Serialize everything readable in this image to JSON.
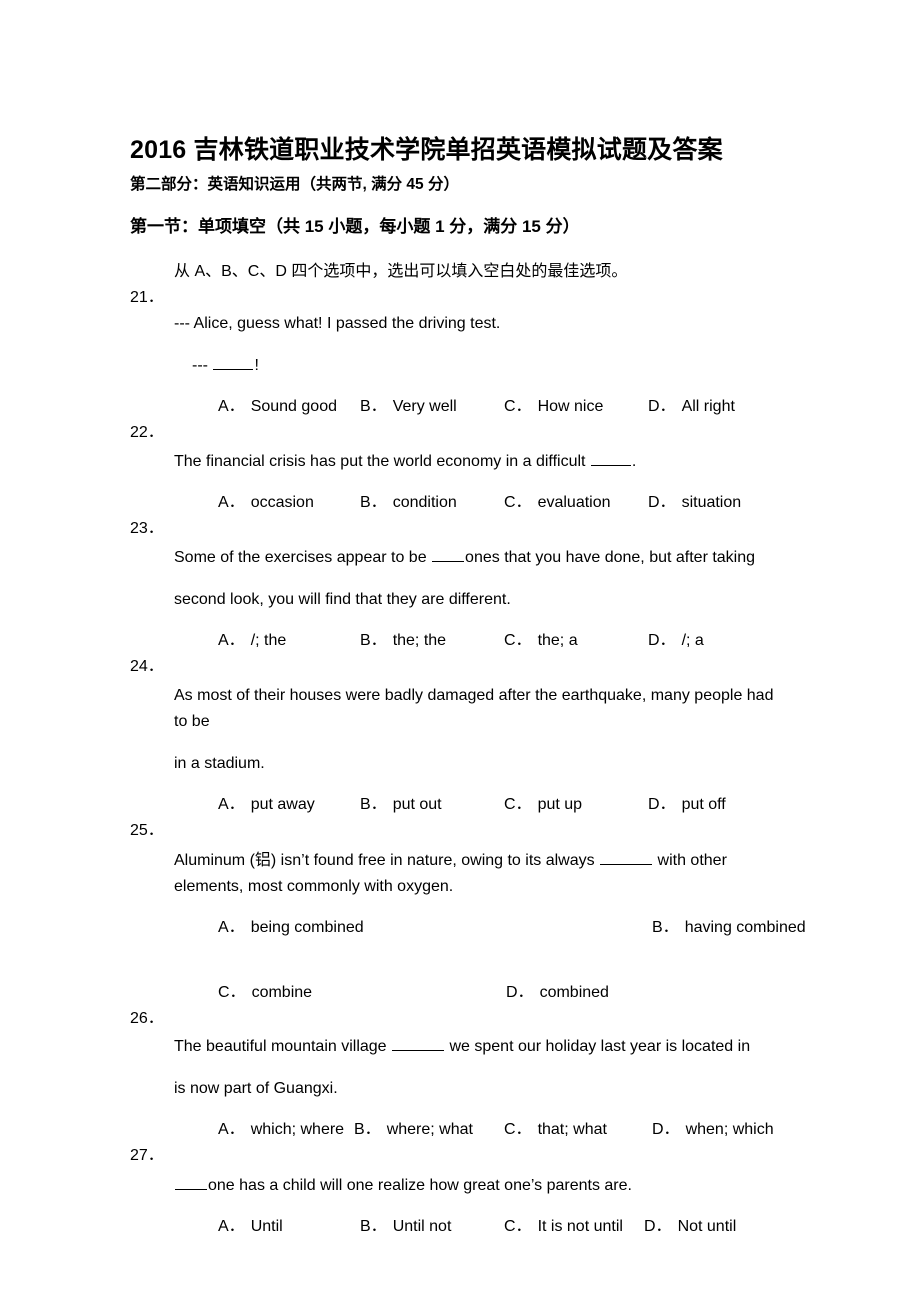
{
  "document": {
    "title": "2016 吉林铁道职业技术学院单招英语模拟试题及答案",
    "part_heading": "第二部分：英语知识运用（共两节, 满分 45 分）",
    "section_heading": "第一节：单项填空（共 15 小题，每小题 1 分，满分 15 分）",
    "instruction": "从 A、B、C、D 四个选项中，选出可以填入空白处的最佳选项。"
  },
  "questions": [
    {
      "number": "21．",
      "lines": [
        "--- Alice, guess what! I passed the driving test.",
        "--- ____!"
      ],
      "options": [
        {
          "label": "A．",
          "text": "Sound good"
        },
        {
          "label": "B．",
          "text": "Very well"
        },
        {
          "label": "C．",
          "text": "How nice"
        },
        {
          "label": "D．",
          "text": "All right"
        }
      ]
    },
    {
      "number": "22．",
      "lines": [
        "The financial crisis has put the world economy in a difficult ____."
      ],
      "options": [
        {
          "label": "A．",
          "text": "occasion"
        },
        {
          "label": "B．",
          "text": "condition"
        },
        {
          "label": "C．",
          "text": "evaluation"
        },
        {
          "label": "D．",
          "text": "situation"
        }
      ]
    },
    {
      "number": "23．",
      "lines": [
        "Some of the exercises appear to be ____ones that you have done, but after taking",
        "second look, you will find that they are different."
      ],
      "options": [
        {
          "label": "A．",
          "text": "/; the"
        },
        {
          "label": "B．",
          "text": "the; the"
        },
        {
          "label": "C．",
          "text": "the; a"
        },
        {
          "label": "D．",
          "text": "/; a"
        }
      ]
    },
    {
      "number": "24．",
      "lines": [
        "As most of their houses were badly damaged after the earthquake, many people had to be",
        "in a stadium."
      ],
      "options": [
        {
          "label": "A．",
          "text": "put away"
        },
        {
          "label": "B．",
          "text": "put out"
        },
        {
          "label": "C．",
          "text": "put up"
        },
        {
          "label": "D．",
          "text": "put off"
        }
      ]
    },
    {
      "number": "25．",
      "lines": [
        "Aluminum (铝) isn’t found free in nature, owing to its always ____ with other elements, most commonly with oxygen."
      ],
      "options": [
        {
          "label": "A．",
          "text": "being combined"
        },
        {
          "label": "B．",
          "text": "having combined"
        },
        {
          "label": "C．",
          "text": "combine"
        },
        {
          "label": "D．",
          "text": "combined"
        }
      ]
    },
    {
      "number": "26．",
      "lines": [
        "The beautiful mountain village _____ we spent our holiday last year is located in",
        "is now part of Guangxi."
      ],
      "options": [
        {
          "label": "A．",
          "text": "which; where"
        },
        {
          "label": "B．",
          "text": "where; what"
        },
        {
          "label": "C．",
          "text": "that; what"
        },
        {
          "label": "D．",
          "text": "when; which"
        }
      ]
    },
    {
      "number": "27．",
      "lines": [
        "____one has a child will one realize how great one’s parents are."
      ],
      "options": [
        {
          "label": "A．",
          "text": "Until"
        },
        {
          "label": "B．",
          "text": "Until not"
        },
        {
          "label": "C．",
          "text": "It is not until"
        },
        {
          "label": "D．",
          "text": "Not until"
        }
      ]
    }
  ]
}
